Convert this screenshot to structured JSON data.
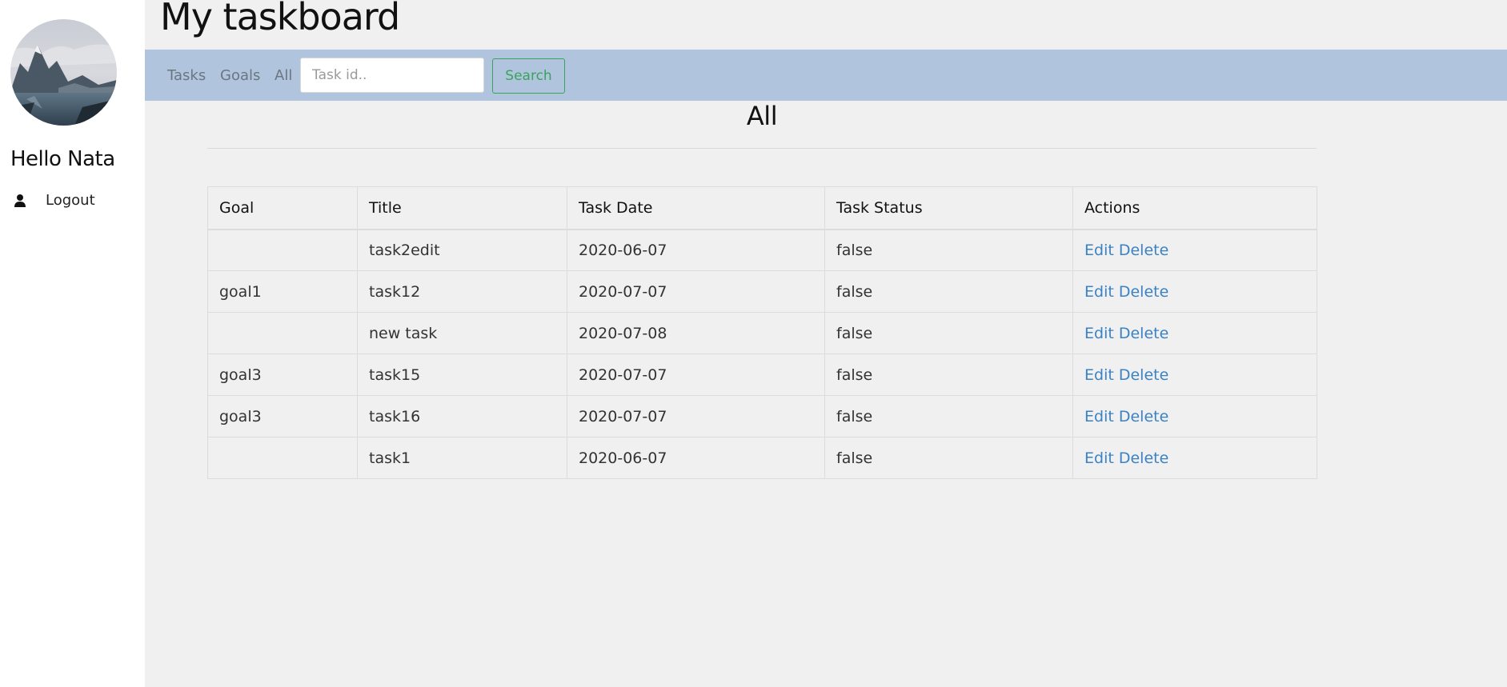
{
  "sidebar": {
    "greeting": "Hello Nata",
    "logout_label": "Logout"
  },
  "header": {
    "title": "My taskboard"
  },
  "nav": {
    "links": [
      "Tasks",
      "Goals",
      "All"
    ],
    "search": {
      "placeholder": "Task id..",
      "value": "",
      "button_label": "Search"
    }
  },
  "section": {
    "title": "All"
  },
  "table": {
    "headers": [
      "Goal",
      "Title",
      "Task Date",
      "Task Status",
      "Actions"
    ],
    "rows": [
      {
        "goal": "",
        "title": "task2edit",
        "date": "2020-06-07",
        "status": "false",
        "edit": "Edit",
        "delete": "Delete"
      },
      {
        "goal": "goal1",
        "title": "task12",
        "date": "2020-07-07",
        "status": "false",
        "edit": "Edit",
        "delete": "Delete"
      },
      {
        "goal": "",
        "title": "new task",
        "date": "2020-07-08",
        "status": "false",
        "edit": "Edit",
        "delete": "Delete"
      },
      {
        "goal": "goal3",
        "title": "task15",
        "date": "2020-07-07",
        "status": "false",
        "edit": "Edit",
        "delete": "Delete"
      },
      {
        "goal": "goal3",
        "title": "task16",
        "date": "2020-07-07",
        "status": "false",
        "edit": "Edit",
        "delete": "Delete"
      },
      {
        "goal": "",
        "title": "task1",
        "date": "2020-06-07",
        "status": "false",
        "edit": "Edit",
        "delete": "Delete"
      }
    ]
  },
  "colors": {
    "navbar_bg": "#b0c4de",
    "main_bg": "#f0f0f0",
    "link": "#3b82c4",
    "search_button": "#3aa35b"
  },
  "icons": {
    "avatar": "mountain-lake-photo",
    "logout": "user-icon"
  }
}
